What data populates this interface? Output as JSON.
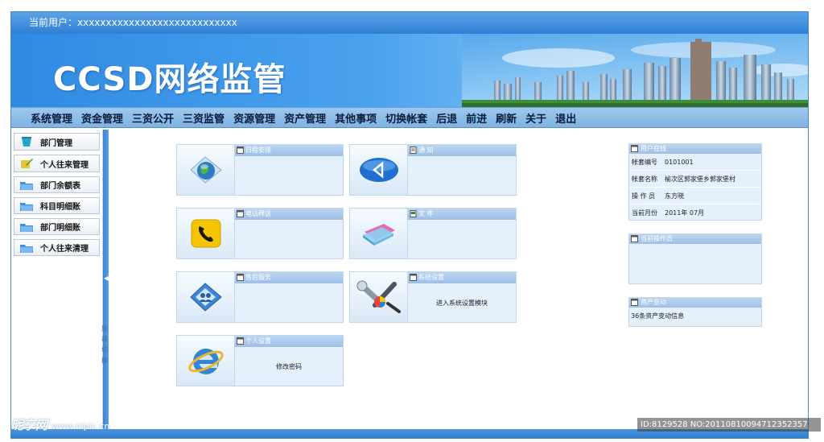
{
  "header": {
    "current_user_label": "当前用户：xxxxxxxxxxxxxxxxxxxxxxxxxxxx",
    "logo_text": "CCSD网络监管"
  },
  "menu": [
    "系统管理",
    "资金管理",
    "三资公开",
    "三资监管",
    "资源管理",
    "资产管理",
    "其他事项",
    "切换帐套",
    "后退",
    "前进",
    "刷新",
    "关于",
    "退出"
  ],
  "sidebar": {
    "items": [
      {
        "label": "部门管理",
        "icon": "cup-icon"
      },
      {
        "label": "个人往来管理",
        "icon": "edit-icon"
      },
      {
        "label": "部门余额表",
        "icon": "folder-icon"
      },
      {
        "label": "科目明细账",
        "icon": "folder-icon"
      },
      {
        "label": "部门明细账",
        "icon": "folder-icon"
      },
      {
        "label": "个人往来清理",
        "icon": "folder-icon"
      }
    ],
    "splitter_label": "屏幕切换"
  },
  "modules": [
    {
      "title": "日程安排",
      "body": "",
      "icon": "globe-icon"
    },
    {
      "title": "通  知",
      "body": "",
      "icon": "speaker-icon"
    },
    {
      "title": "电话拜访",
      "body": "",
      "icon": "phone-icon"
    },
    {
      "title": "文  件",
      "body": "",
      "icon": "files-icon"
    },
    {
      "title": "售后服务",
      "body": "",
      "icon": "users-icon"
    },
    {
      "title": "系统设置",
      "body": "进入系统设置模块",
      "icon": "tools-icon"
    },
    {
      "title": "个人设置",
      "body": "修改密码",
      "icon": "browser-icon"
    }
  ],
  "right_panels": {
    "user_online": {
      "title": "用户在线",
      "rows": [
        {
          "k": "帐套编号",
          "v": "0101001"
        },
        {
          "k": "帐套名称",
          "v": "榆次区郭家堡乡郭家堡村"
        },
        {
          "k": "操 作 员",
          "v": "东方晓"
        },
        {
          "k": "当前月份",
          "v": "2011年 07月"
        }
      ]
    },
    "current_operator": {
      "title": "当前操作员"
    },
    "asset_changes": {
      "title": "资产变动",
      "text": "36条资产变动信息"
    }
  },
  "watermark": {
    "left_main": "昵享网",
    "left_url": "www.nipic.cn",
    "right": "ID:8129528 NO:20110810094712352357"
  },
  "colors": {
    "accent": "#2f7fd4",
    "menu_bg": "#9cc8ee",
    "module_bg": "#dcebf8"
  }
}
